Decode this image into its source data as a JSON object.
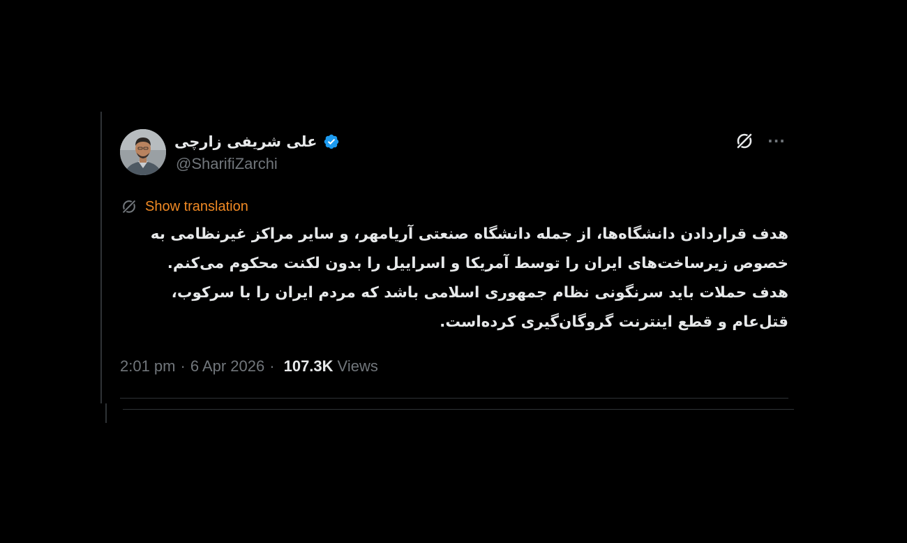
{
  "author": {
    "display_name": "علی شریفی زارچی",
    "handle": "@SharifiZarchi",
    "verified": true,
    "verified_color": "#1d9bf0"
  },
  "actions": {
    "grok_icon": "grok-icon",
    "more_icon": "more-icon",
    "more_label": "···"
  },
  "translation": {
    "label": "Show translation",
    "color": "#f18a24"
  },
  "tweet": {
    "lines": [
      "هدف قراردادن دانشگاه‌ها، از جمله دانشگاه صنعتی آریامهر، و سایر مراکز غیرنظامی به",
      "خصوص زیرساخت‌های ایران را توسط آمریکا و اسراییل را بدون لکنت محکوم می‌کنم.",
      "هدف حملات باید سرنگونی نظام جمهوری اسلامی باشد که مردم ایران را با سرکوب،",
      "قتل‌عام و قطع اینترنت گروگان‌گیری کرده‌است."
    ]
  },
  "meta": {
    "time": "2:01 pm",
    "date": "6 Apr 2026",
    "views_count": "107.3K",
    "views_label": "Views",
    "separator": "·"
  },
  "colors": {
    "background": "#000000",
    "text_primary": "#e7e9ea",
    "text_secondary": "#71767b",
    "border": "#2f3336"
  }
}
